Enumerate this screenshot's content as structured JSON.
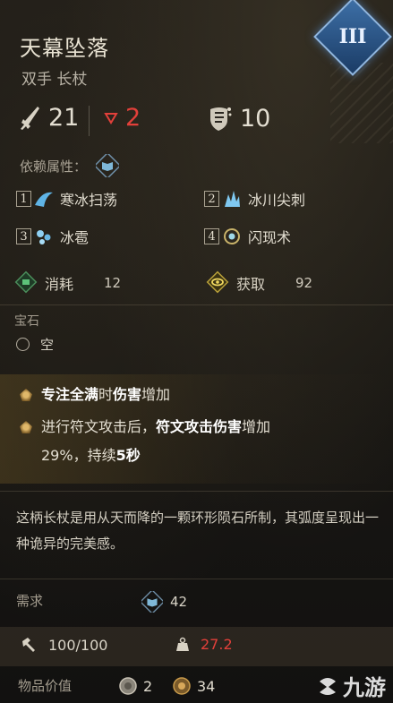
{
  "item": {
    "name": "天幕坠落",
    "type": "双手 长杖",
    "tier_badge": "III"
  },
  "stats": {
    "attack": "21",
    "attack_icon": "sword-icon",
    "penalty": "2",
    "penalty_icon": "down-arrow-icon",
    "defense": "10",
    "defense_icon": "fist-shield-icon"
  },
  "attribute_req_label": "依赖属性：",
  "skills": [
    {
      "num": "1",
      "name": "寒冰扫荡"
    },
    {
      "num": "2",
      "name": "冰川尖刺"
    },
    {
      "num": "3",
      "name": "冰雹"
    },
    {
      "num": "4",
      "name": "闪现术"
    }
  ],
  "resources": {
    "consume_label": "消耗",
    "consume_value": "12",
    "gain_label": "获取",
    "gain_value": "92"
  },
  "gems": {
    "title": "宝石",
    "slot_label": "空"
  },
  "affixes": {
    "a1_p1": "专注全满",
    "a1_p2": "时",
    "a1_p3": "伤害",
    "a1_p4": "增加",
    "a2_p1": "进行符文攻击后，",
    "a2_p2": "符文攻击",
    "a2_p3": "伤害",
    "a2_p4": "增加",
    "a2_line2_p1": "29%，持续",
    "a2_line2_p2": "5秒"
  },
  "flavor": "这柄长杖是用从天而降的一颗环形陨石所制，其弧度呈现出一种诡异的完美感。",
  "requirement": {
    "label": "需求",
    "value": "42"
  },
  "durability": {
    "value": "100/100",
    "weight": "27.2"
  },
  "item_value": {
    "label": "物品价值",
    "silver": "2",
    "gold": "34"
  },
  "watermark": "九游",
  "colors": {
    "accent_blue": "#3d6fa6",
    "red_text": "#e2403a",
    "gold_bullet": "#e0b86a"
  }
}
